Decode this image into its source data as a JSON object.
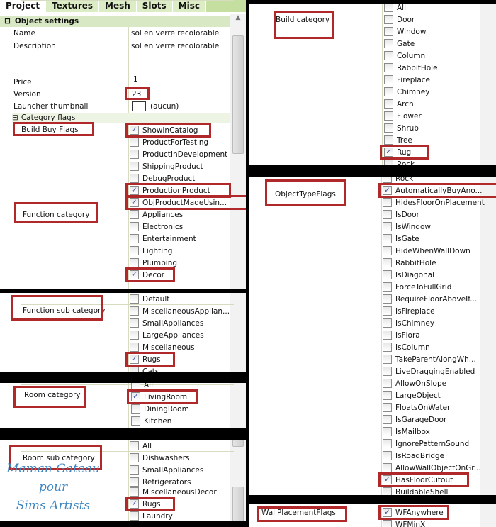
{
  "tabs": [
    "Project",
    "Textures",
    "Mesh",
    "Slots",
    "Misc"
  ],
  "object_settings": {
    "title": "Object settings",
    "name_label": "Name",
    "name_value": "sol en verre recolorable",
    "description_label": "Description",
    "description_value": "sol en verre recolorable",
    "price_label": "Price",
    "price_value": "1",
    "version_label": "Version",
    "version_value": "23",
    "thumbnail_label": "Launcher thumbnail",
    "thumbnail_value": "(aucun)",
    "category_flags": "Category flags"
  },
  "build_buy_flags": {
    "label": "Build Buy Flags",
    "items": [
      {
        "text": "ShowInCatalog",
        "checked": true,
        "highlighted": true
      },
      {
        "text": "ProductForTesting",
        "checked": false
      },
      {
        "text": "ProductInDevelopment",
        "checked": false
      },
      {
        "text": "ShippingProduct",
        "checked": false
      },
      {
        "text": "DebugProduct",
        "checked": false
      },
      {
        "text": "ProductionProduct",
        "checked": true,
        "highlighted": true
      },
      {
        "text": "ObjProductMadeUsin...",
        "checked": true,
        "highlighted": true
      }
    ]
  },
  "function_category": {
    "label": "Function category",
    "items": [
      {
        "text": "Appliances",
        "checked": false
      },
      {
        "text": "Electronics",
        "checked": false
      },
      {
        "text": "Entertainment",
        "checked": false
      },
      {
        "text": "Lighting",
        "checked": false
      },
      {
        "text": "Plumbing",
        "checked": false
      },
      {
        "text": "Decor",
        "checked": true,
        "highlighted": true
      }
    ]
  },
  "function_sub_category": {
    "label": "Function sub category",
    "items": [
      {
        "text": "Default",
        "checked": false
      },
      {
        "text": "MiscellaneousApplian...",
        "checked": false
      },
      {
        "text": "SmallAppliances",
        "checked": false
      },
      {
        "text": "LargeAppliances",
        "checked": false
      },
      {
        "text": "Miscellaneous",
        "checked": false
      },
      {
        "text": "Rugs",
        "checked": true,
        "highlighted": true
      },
      {
        "text": "Cats",
        "checked": false
      }
    ]
  },
  "room_category": {
    "label": "Room category",
    "items": [
      {
        "text": "All",
        "checked": false
      },
      {
        "text": "LivingRoom",
        "checked": true,
        "highlighted": true
      },
      {
        "text": "DiningRoom",
        "checked": false
      },
      {
        "text": "Kitchen",
        "checked": false
      }
    ]
  },
  "room_sub_category": {
    "label": "Room sub category",
    "items": [
      {
        "text": "All",
        "checked": false
      },
      {
        "text": "Dishwashers",
        "checked": false
      },
      {
        "text": "SmallAppliances",
        "checked": false
      },
      {
        "text": "Refrigerators",
        "checked": false
      },
      {
        "text": "MiscellaneousDecor",
        "checked": false
      },
      {
        "text": "Rugs",
        "checked": true,
        "highlighted": true
      },
      {
        "text": "Laundry",
        "checked": false
      }
    ]
  },
  "build_category": {
    "label": "Build category",
    "items": [
      {
        "text": "All",
        "checked": false
      },
      {
        "text": "Door",
        "checked": false
      },
      {
        "text": "Window",
        "checked": false
      },
      {
        "text": "Gate",
        "checked": false
      },
      {
        "text": "Column",
        "checked": false
      },
      {
        "text": "RabbitHole",
        "checked": false
      },
      {
        "text": "Fireplace",
        "checked": false
      },
      {
        "text": "Chimney",
        "checked": false
      },
      {
        "text": "Arch",
        "checked": false
      },
      {
        "text": "Flower",
        "checked": false
      },
      {
        "text": "Shrub",
        "checked": false
      },
      {
        "text": "Tree",
        "checked": false
      },
      {
        "text": "Rug",
        "checked": true,
        "highlighted": true
      },
      {
        "text": "Rock",
        "checked": false
      }
    ]
  },
  "object_type_flags": {
    "label": "ObjectTypeFlags",
    "items": [
      {
        "text": "Rock",
        "checked": false
      },
      {
        "text": "AutomaticallyBuyAno...",
        "checked": true,
        "highlighted": true
      },
      {
        "text": "HidesFloorOnPlacement",
        "checked": false
      },
      {
        "text": "IsDoor",
        "checked": false
      },
      {
        "text": "IsWindow",
        "checked": false
      },
      {
        "text": "IsGate",
        "checked": false
      },
      {
        "text": "HideWhenWallDown",
        "checked": false
      },
      {
        "text": "RabbitHole",
        "checked": false
      },
      {
        "text": "IsDiagonal",
        "checked": false
      },
      {
        "text": "ForceToFullGrid",
        "checked": false
      },
      {
        "text": "RequireFloorAboveIf...",
        "checked": false
      },
      {
        "text": "IsFireplace",
        "checked": false
      },
      {
        "text": "IsChimney",
        "checked": false
      },
      {
        "text": "IsFlora",
        "checked": false
      },
      {
        "text": "IsColumn",
        "checked": false
      },
      {
        "text": "TakeParentAlongWh...",
        "checked": false
      },
      {
        "text": "LiveDraggingEnabled",
        "checked": false
      },
      {
        "text": "AllowOnSlope",
        "checked": false
      },
      {
        "text": "LargeObject",
        "checked": false
      },
      {
        "text": "FloatsOnWater",
        "checked": false
      },
      {
        "text": "IsGarageDoor",
        "checked": false
      },
      {
        "text": "IsMailbox",
        "checked": false
      },
      {
        "text": "IgnorePatternSound",
        "checked": false
      },
      {
        "text": "IsRoadBridge",
        "checked": false
      },
      {
        "text": "AllowWallObjectOnGr...",
        "checked": false
      },
      {
        "text": "HasFloorCutout",
        "checked": true,
        "highlighted": true
      },
      {
        "text": "BuildableShell",
        "checked": false
      }
    ]
  },
  "wall_placement_flags": {
    "label": "WallPlacementFlags",
    "items": [
      {
        "text": "WFAnywhere",
        "checked": true,
        "highlighted": true
      },
      {
        "text": "WFMinX",
        "checked": false
      }
    ]
  },
  "watermark": [
    "Maman Gateau",
    "pour",
    "Sims Artists"
  ],
  "colors": {
    "highlight": "#b0282a",
    "header_green": "#d8e8c4",
    "check": "#3a4fa0"
  }
}
